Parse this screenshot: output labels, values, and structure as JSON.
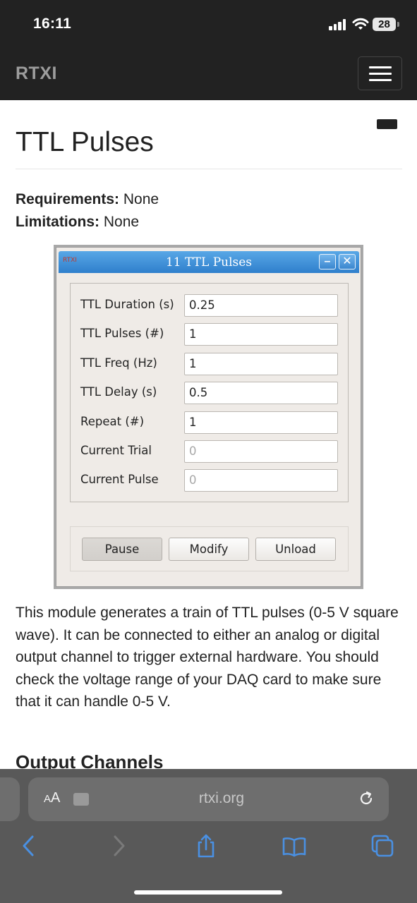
{
  "status_bar": {
    "time": "16:11",
    "battery_level": "28"
  },
  "navbar": {
    "brand": "RTXI"
  },
  "page": {
    "title": "TTL Pulses",
    "requirements_label": "Requirements:",
    "requirements_value": "None",
    "limitations_label": "Limitations:",
    "limitations_value": "None",
    "description": "This module generates a train of TTL pulses (0-5 V square wave). It can be connected to either an analog or digital output channel to trigger external hardware. You should check the voltage range of your DAQ card to make sure that it can handle 0-5 V.",
    "next_section": "Output Channels"
  },
  "module_window": {
    "logo": "RTXI",
    "title": "11 TTL Pulses",
    "minimize_symbol": "–",
    "close_symbol": "✕",
    "parameters": [
      {
        "label": "TTL Duration (s)",
        "value": "0.25",
        "editable": true
      },
      {
        "label": "TTL Pulses (#)",
        "value": "1",
        "editable": true
      },
      {
        "label": "TTL Freq (Hz)",
        "value": "1",
        "editable": true
      },
      {
        "label": "TTL Delay (s)",
        "value": "0.5",
        "editable": true
      },
      {
        "label": "Repeat (#)",
        "value": "1",
        "editable": true
      },
      {
        "label": "Current Trial",
        "value": "0",
        "editable": false
      },
      {
        "label": "Current Pulse",
        "value": "0",
        "editable": false
      }
    ],
    "buttons": {
      "pause": "Pause",
      "modify": "Modify",
      "unload": "Unload"
    }
  },
  "browser": {
    "aa_label_small": "A",
    "aa_label_large": "A",
    "url": "rtxi.org",
    "accent_color": "#4a90e2"
  }
}
